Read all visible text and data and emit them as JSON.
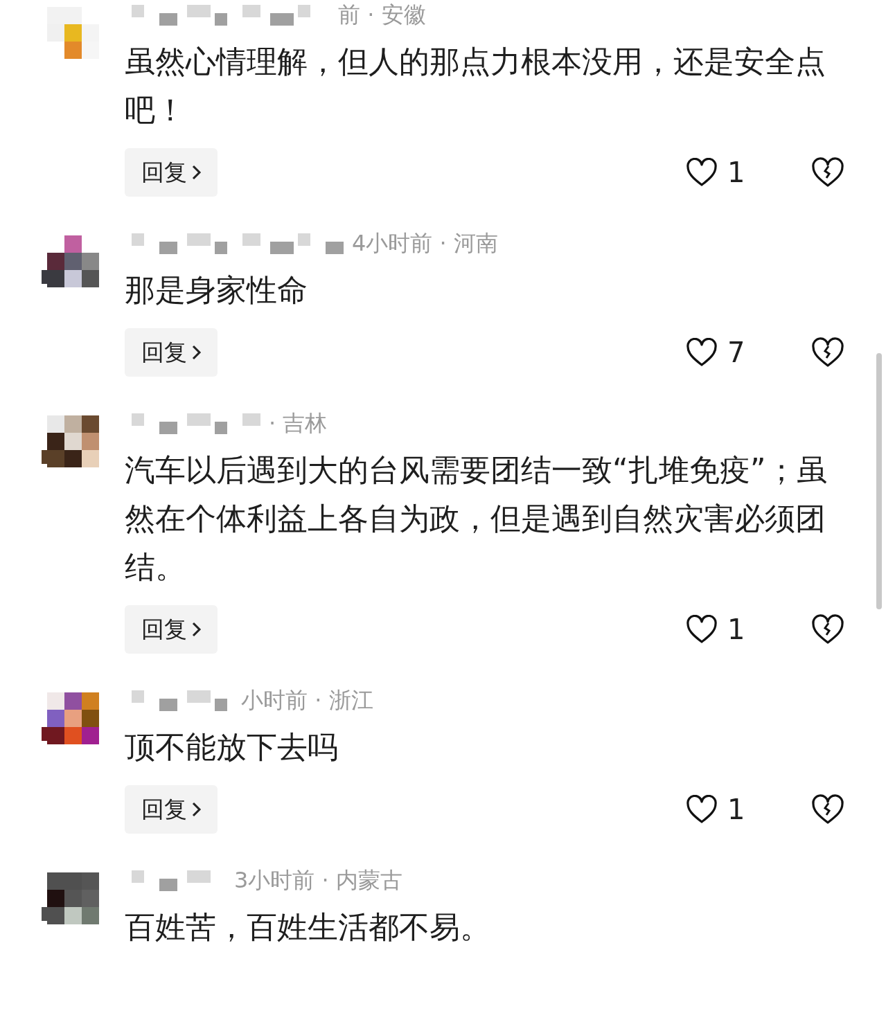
{
  "comments": [
    {
      "meta": "前 · 安徽",
      "text": "虽然心情理解，但人的那点力根本没用，还是安全点吧！",
      "reply": "回复",
      "likes": "1"
    },
    {
      "meta": "4小时前 · 河南",
      "text": "那是身家性命",
      "reply": "回复",
      "likes": "7"
    },
    {
      "meta": "· 吉林",
      "text": "汽车以后遇到大的台风需要团结一致“扎堆免疫”；虽然在个体利益上各自为政，但是遇到自然灾害必须团结。",
      "reply": "回复",
      "likes": "1"
    },
    {
      "meta": "小时前 · 浙江",
      "text": "顶不能放下去吗",
      "reply": "回复",
      "likes": "1"
    },
    {
      "meta": "3小时前 · 内蒙古",
      "text": "百姓苦，百姓生活都不易。"
    }
  ]
}
